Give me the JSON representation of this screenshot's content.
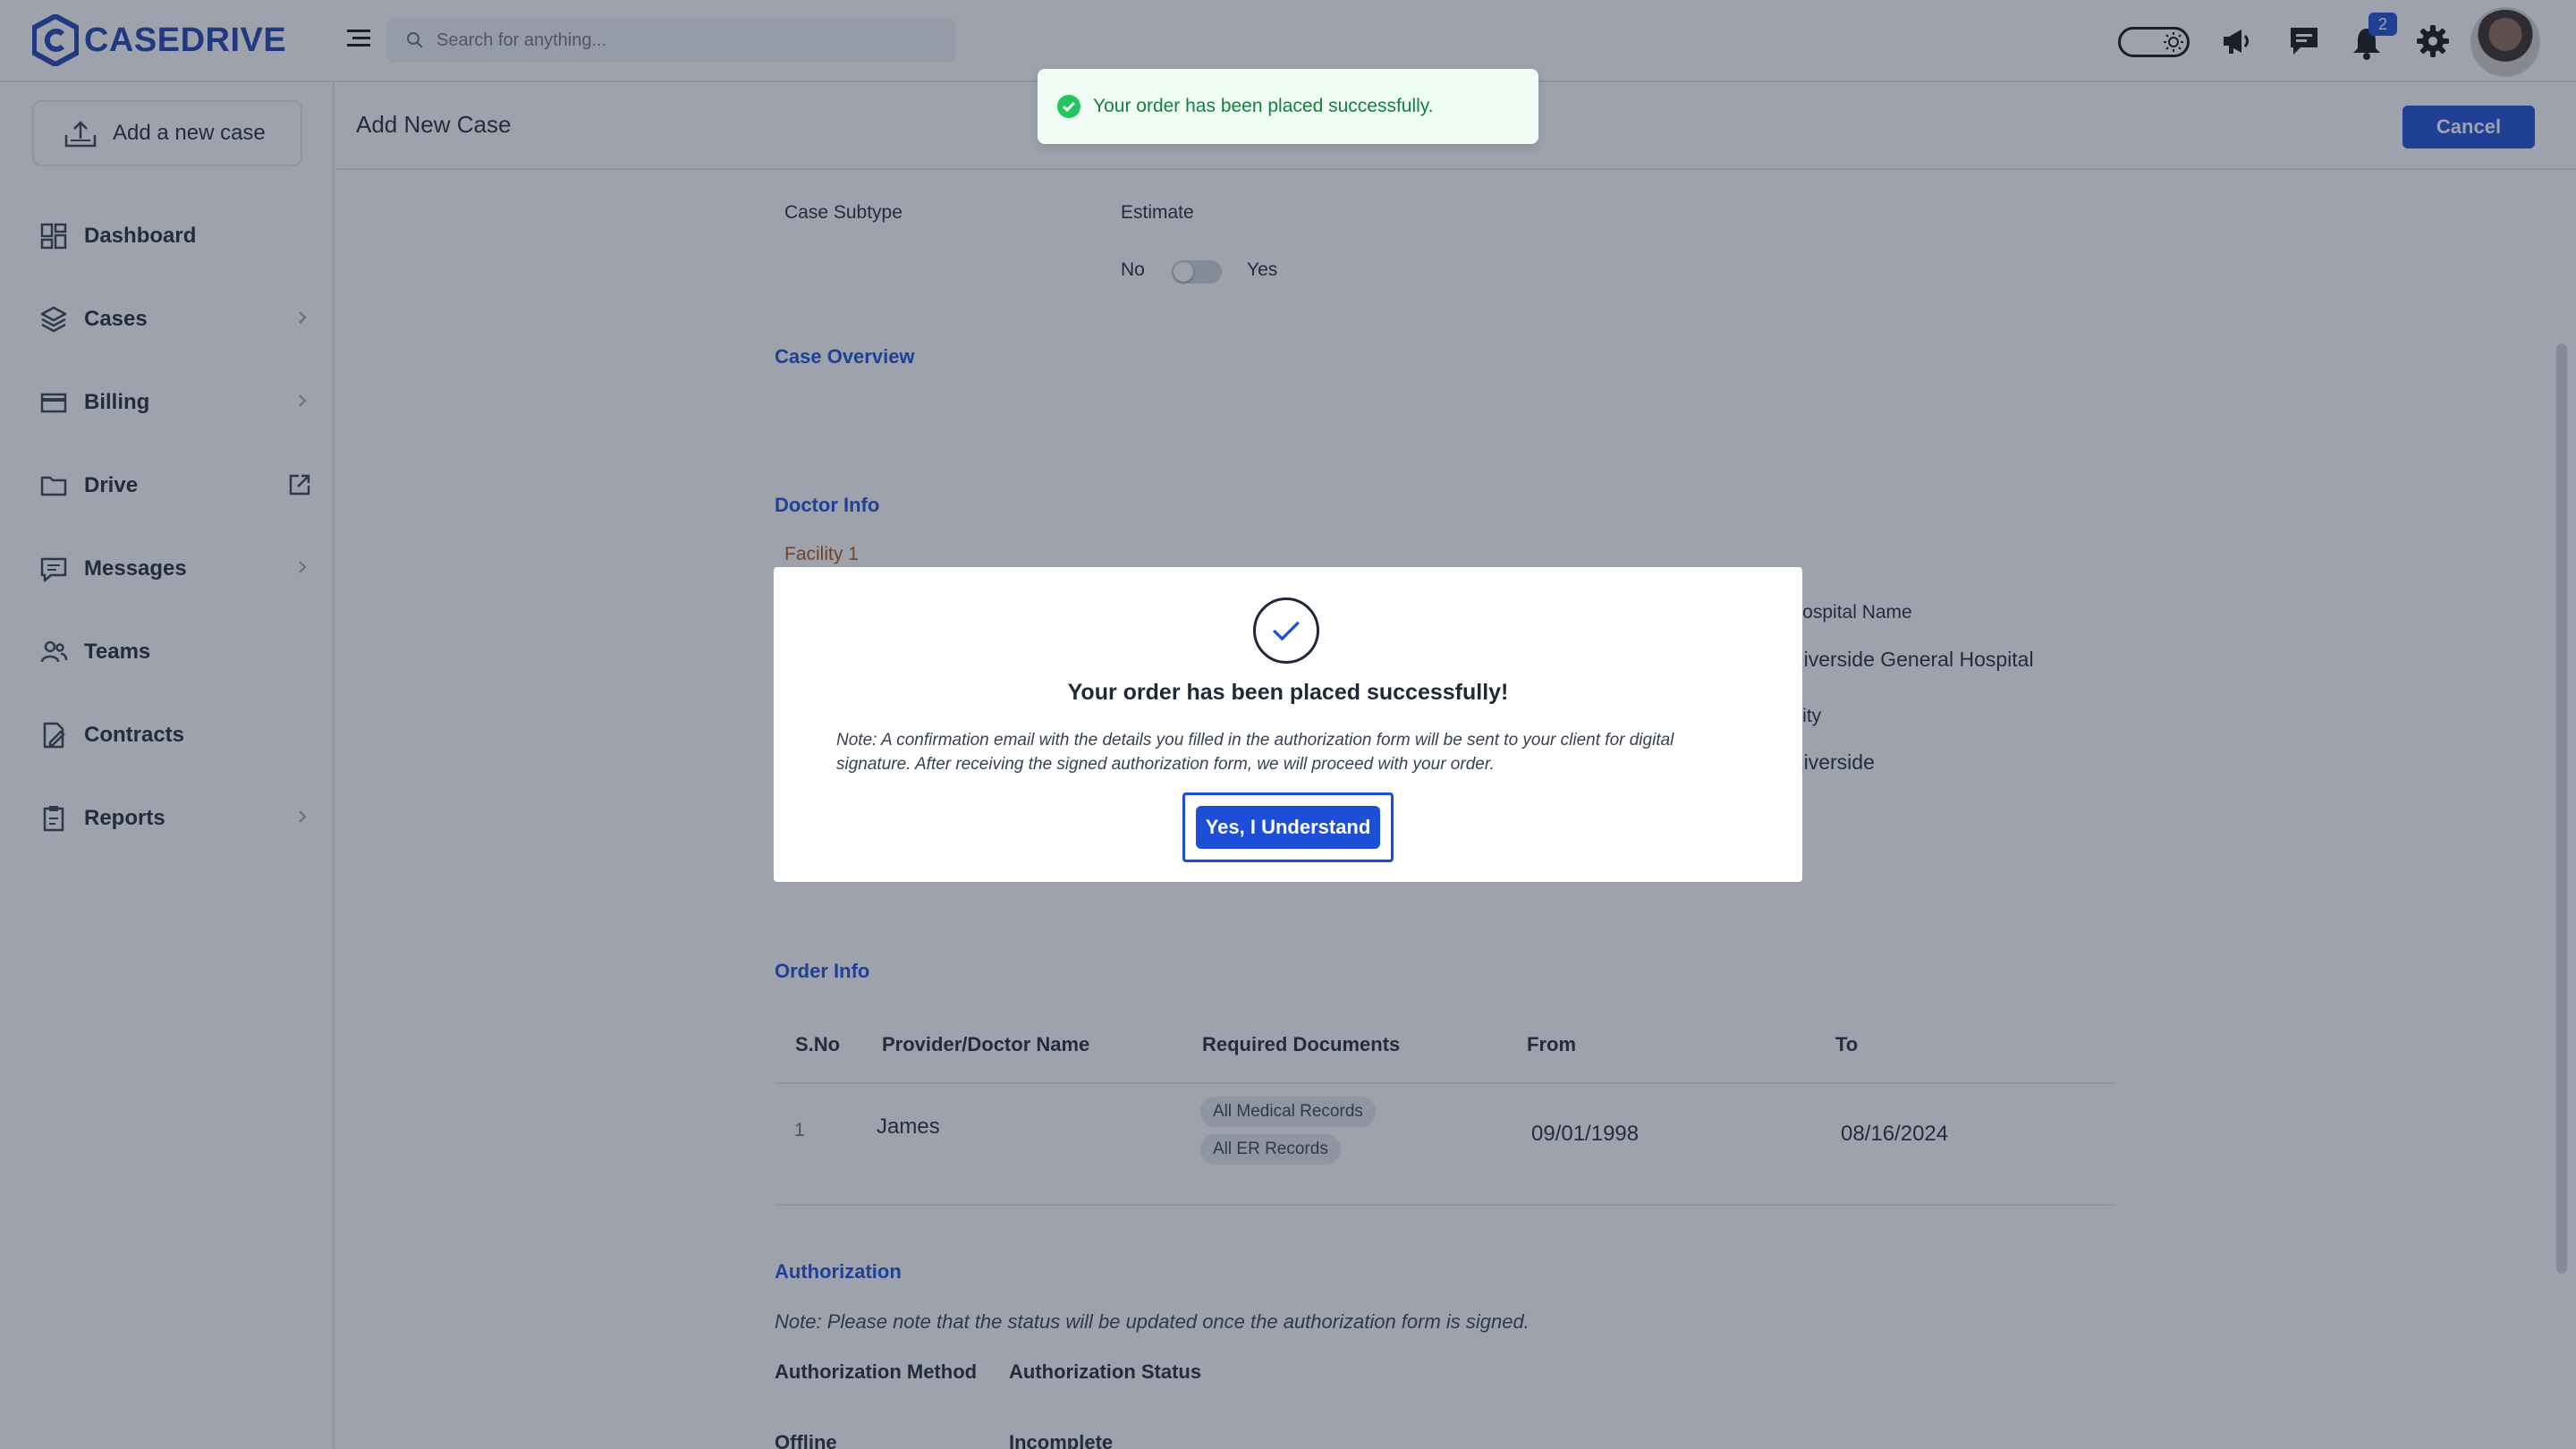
{
  "app": {
    "brand": "CASEDRIVE"
  },
  "header": {
    "search_placeholder": "Search for anything...",
    "notification_count": "2"
  },
  "sidebar": {
    "add_case_label": "Add a new case",
    "items": [
      {
        "label": "Dashboard",
        "icon": "dashboard-icon",
        "chevron": false
      },
      {
        "label": "Cases",
        "icon": "layers-icon",
        "chevron": true
      },
      {
        "label": "Billing",
        "icon": "card-icon",
        "chevron": true
      },
      {
        "label": "Drive",
        "icon": "folder-icon",
        "chevron": false
      },
      {
        "label": "Messages",
        "icon": "message-icon",
        "chevron": true
      },
      {
        "label": "Teams",
        "icon": "users-icon",
        "chevron": false
      },
      {
        "label": "Contracts",
        "icon": "contract-icon",
        "chevron": false
      },
      {
        "label": "Reports",
        "icon": "clipboard-icon",
        "chevron": true
      }
    ]
  },
  "page": {
    "title": "Add New Case",
    "cancel_label": "Cancel"
  },
  "form": {
    "case_subtype_label": "Case Subtype",
    "case_subtype_value": "Estimate",
    "toggle_no": "No",
    "toggle_yes": "Yes",
    "toggle_on": false,
    "case_overview_heading": "Case Overview",
    "doctor_info_heading": "Doctor Info",
    "facility_label": "Facility 1",
    "hospital_name_label": "Hospital Name",
    "hospital_name_value": "Riverside General Hospital",
    "city_label": "City",
    "city_value": "Riverside"
  },
  "order_info": {
    "heading": "Order Info",
    "columns": [
      "S.No",
      "Provider/Doctor Name",
      "Required Documents",
      "From",
      "To"
    ],
    "rows": [
      {
        "sno": "1",
        "provider": "James",
        "documents": [
          "All Medical Records",
          "All ER Records"
        ],
        "from": "09/01/1998",
        "to": "08/16/2024"
      }
    ]
  },
  "authorization": {
    "heading": "Authorization",
    "note": "Note: Please note that the status will be updated once the authorization form is signed.",
    "method_label": "Authorization Method",
    "status_label": "Authorization Status",
    "method_value": "Offline",
    "status_value": "Incomplete"
  },
  "toast": {
    "message": "Your order has been placed successfully."
  },
  "modal": {
    "title": "Your order has been placed successfully!",
    "note": "Note: A confirmation email with the details you filled in the authorization form will be sent to your client for digital signature. After receiving the signed authorization form, we will proceed with your order.",
    "button_label": "Yes, I Understand"
  },
  "colors": {
    "brand": "#1e40af",
    "accent": "#1d4ed8",
    "success": "#22c55e",
    "facility": "#b45309"
  }
}
